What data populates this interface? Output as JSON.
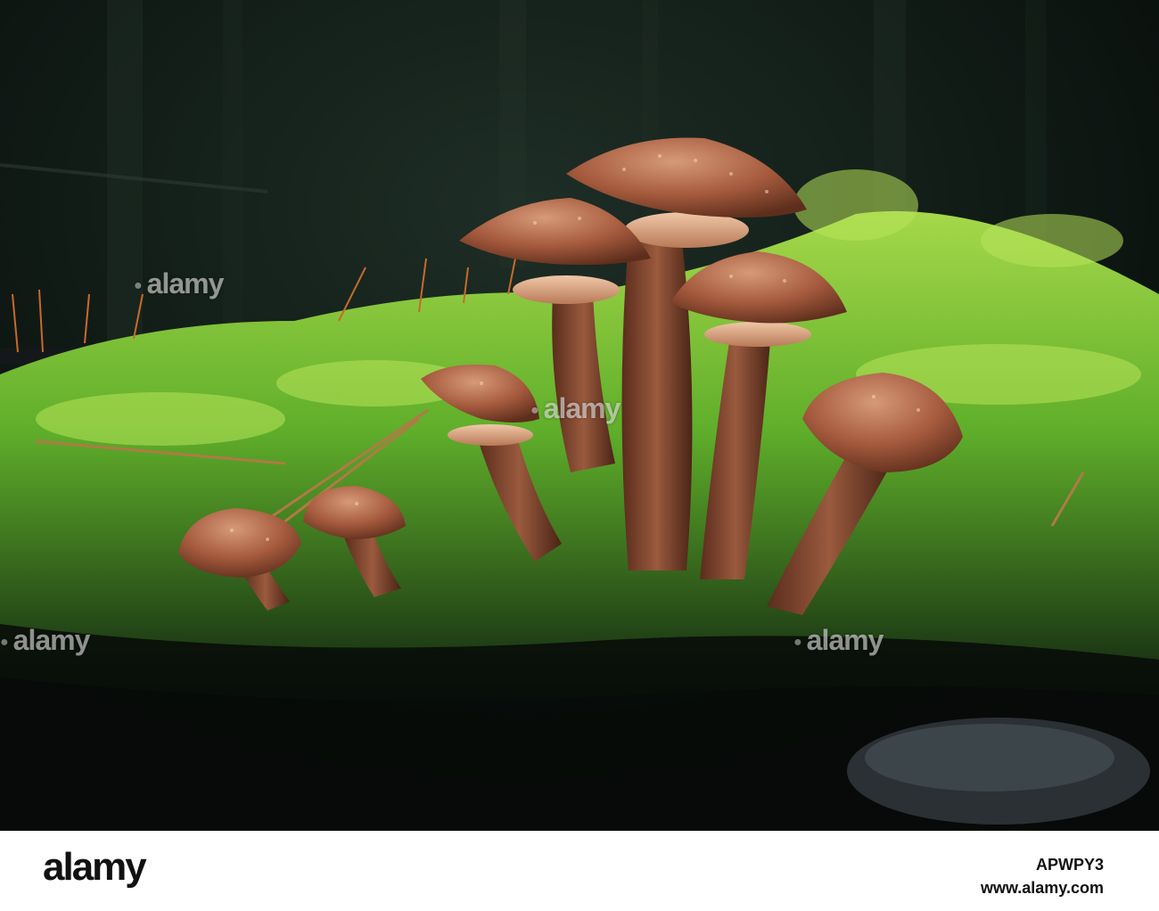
{
  "photo": {
    "subject": "Cluster of honey fungus mushrooms on a moss-covered log in a dark forest",
    "colors": {
      "background": "#0b1410",
      "moss": "#5fae2a",
      "moss_highlight": "#a6d84a",
      "mushroom_cap": "#a65b3e",
      "mushroom_stem": "#8a4a32"
    }
  },
  "watermark": {
    "text": "alamy"
  },
  "footer": {
    "logo": "alamy",
    "image_id": "APWPY3",
    "url": "www.alamy.com"
  }
}
